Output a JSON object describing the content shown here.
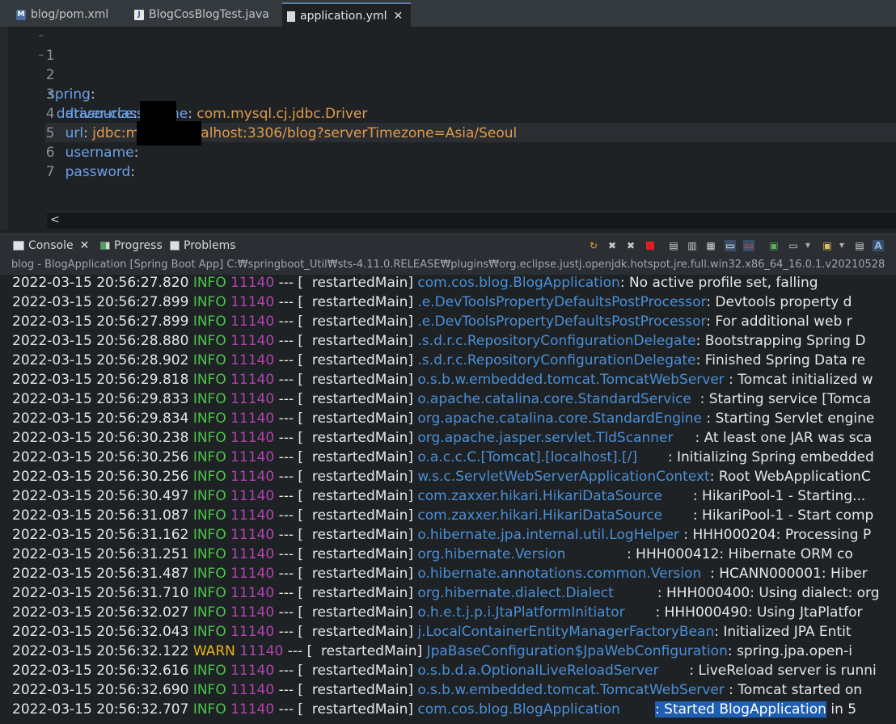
{
  "editor_tabs": [
    {
      "label": "blog/pom.xml",
      "icon": "maven-file-icon"
    },
    {
      "label": "BlogCosBlogTest.java",
      "icon": "java-file-icon"
    },
    {
      "label": "application.yml",
      "icon": "yaml-file-icon",
      "active": true
    }
  ],
  "editor": {
    "lines": [
      {
        "no": "1",
        "fold": "−",
        "key": "spring",
        "colon": ":",
        "value": ""
      },
      {
        "no": "2",
        "fold": "−",
        "key": "  datasource",
        "colon": ":",
        "value": ""
      },
      {
        "no": "3",
        "key": "    driver-class-name",
        "colon": ": ",
        "value": "com.mysql.cj.jdbc.Driver"
      },
      {
        "no": "4",
        "key": "    url",
        "colon": ": ",
        "value": "jdbc:mysql://localhost:3306/blog?serverTimezone=Asia/Seoul"
      },
      {
        "no": "5",
        "key": "    username",
        "colon": ":",
        "value": ""
      },
      {
        "no": "6",
        "key": "    password",
        "colon": ":",
        "value": ""
      },
      {
        "no": "7",
        "key": "",
        "colon": "",
        "value": ""
      }
    ],
    "hscroll_arrow": "<"
  },
  "console_tabs": [
    {
      "label": "Console",
      "icon": "console-icon",
      "close": "✕"
    },
    {
      "label": "Progress",
      "icon": "progress-icon"
    },
    {
      "label": "Problems",
      "icon": "problems-icon"
    }
  ],
  "console_header": "blog - BlogApplication [Spring Boot App] C:₩springboot_Util₩sts-4.11.0.RELEASE₩plugins₩org.eclipse.justj.openjdk.hotspot.jre.full.win32.x86_64_16.0.1.v20210528",
  "log_lines": [
    {
      "ts": "2022-03-15 20:56:27.820",
      "level": "INFO",
      "pid": "11140",
      "thread": "[  restartedMain]",
      "logger": "com.cos.blog.BlogApplication",
      "msg": ": No active profile set, falling"
    },
    {
      "ts": "2022-03-15 20:56:27.899",
      "level": "INFO",
      "pid": "11140",
      "thread": "[  restartedMain]",
      "logger": ".e.DevToolsPropertyDefaultsPostProcessor",
      "msg": ": Devtools property d"
    },
    {
      "ts": "2022-03-15 20:56:27.899",
      "level": "INFO",
      "pid": "11140",
      "thread": "[  restartedMain]",
      "logger": ".e.DevToolsPropertyDefaultsPostProcessor",
      "msg": ": For additional web r"
    },
    {
      "ts": "2022-03-15 20:56:28.880",
      "level": "INFO",
      "pid": "11140",
      "thread": "[  restartedMain]",
      "logger": ".s.d.r.c.RepositoryConfigurationDelegate",
      "msg": ": Bootstrapping Spring D"
    },
    {
      "ts": "2022-03-15 20:56:28.902",
      "level": "INFO",
      "pid": "11140",
      "thread": "[  restartedMain]",
      "logger": ".s.d.r.c.RepositoryConfigurationDelegate",
      "msg": ": Finished Spring Data re"
    },
    {
      "ts": "2022-03-15 20:56:29.818",
      "level": "INFO",
      "pid": "11140",
      "thread": "[  restartedMain]",
      "logger": "o.s.b.w.embedded.tomcat.TomcatWebServer",
      "msg": " : Tomcat initialized w"
    },
    {
      "ts": "2022-03-15 20:56:29.833",
      "level": "INFO",
      "pid": "11140",
      "thread": "[  restartedMain]",
      "logger": "o.apache.catalina.core.StandardService",
      "msg": "  : Starting service [Tomca"
    },
    {
      "ts": "2022-03-15 20:56:29.834",
      "level": "INFO",
      "pid": "11140",
      "thread": "[  restartedMain]",
      "logger": "org.apache.catalina.core.StandardEngine",
      "msg": " : Starting Servlet engine"
    },
    {
      "ts": "2022-03-15 20:56:30.238",
      "level": "INFO",
      "pid": "11140",
      "thread": "[  restartedMain]",
      "logger": "org.apache.jasper.servlet.TldScanner",
      "msg": "     : At least one JAR was sca"
    },
    {
      "ts": "2022-03-15 20:56:30.256",
      "level": "INFO",
      "pid": "11140",
      "thread": "[  restartedMain]",
      "logger": "o.a.c.c.C.[Tomcat].[localhost].[/]",
      "msg": "       : Initializing Spring embedded"
    },
    {
      "ts": "2022-03-15 20:56:30.256",
      "level": "INFO",
      "pid": "11140",
      "thread": "[  restartedMain]",
      "logger": "w.s.c.ServletWebServerApplicationContext",
      "msg": ": Root WebApplicationC"
    },
    {
      "ts": "2022-03-15 20:56:30.497",
      "level": "INFO",
      "pid": "11140",
      "thread": "[  restartedMain]",
      "logger": "com.zaxxer.hikari.HikariDataSource",
      "msg": "       : HikariPool-1 - Starting..."
    },
    {
      "ts": "2022-03-15 20:56:31.087",
      "level": "INFO",
      "pid": "11140",
      "thread": "[  restartedMain]",
      "logger": "com.zaxxer.hikari.HikariDataSource",
      "msg": "       : HikariPool-1 - Start comp"
    },
    {
      "ts": "2022-03-15 20:56:31.162",
      "level": "INFO",
      "pid": "11140",
      "thread": "[  restartedMain]",
      "logger": "o.hibernate.jpa.internal.util.LogHelper",
      "msg": " : HHH000204: Processing P"
    },
    {
      "ts": "2022-03-15 20:56:31.251",
      "level": "INFO",
      "pid": "11140",
      "thread": "[  restartedMain]",
      "logger": "org.hibernate.Version",
      "msg": "              : HHH000412: Hibernate ORM co"
    },
    {
      "ts": "2022-03-15 20:56:31.487",
      "level": "INFO",
      "pid": "11140",
      "thread": "[  restartedMain]",
      "logger": "o.hibernate.annotations.common.Version",
      "msg": "  : HCANN000001: Hiber"
    },
    {
      "ts": "2022-03-15 20:56:31.710",
      "level": "INFO",
      "pid": "11140",
      "thread": "[  restartedMain]",
      "logger": "org.hibernate.dialect.Dialect",
      "msg": "          : HHH000400: Using dialect: org"
    },
    {
      "ts": "2022-03-15 20:56:32.027",
      "level": "INFO",
      "pid": "11140",
      "thread": "[  restartedMain]",
      "logger": "o.h.e.t.j.p.i.JtaPlatformInitiator",
      "msg": "       : HHH000490: Using JtaPlatfor"
    },
    {
      "ts": "2022-03-15 20:56:32.043",
      "level": "INFO",
      "pid": "11140",
      "thread": "[  restartedMain]",
      "logger": "j.LocalContainerEntityManagerFactoryBean",
      "msg": ": Initialized JPA Entit"
    },
    {
      "ts": "2022-03-15 20:56:32.122",
      "level": "WARN",
      "pid": "11140",
      "thread": "[  restartedMain]",
      "logger": "JpaBaseConfiguration$JpaWebConfiguration",
      "msg": ": spring.jpa.open-i"
    },
    {
      "ts": "2022-03-15 20:56:32.616",
      "level": "INFO",
      "pid": "11140",
      "thread": "[  restartedMain]",
      "logger": "o.s.b.d.a.OptionalLiveReloadServer",
      "msg": "       : LiveReload server is runni"
    },
    {
      "ts": "2022-03-15 20:56:32.690",
      "level": "INFO",
      "pid": "11140",
      "thread": "[  restartedMain]",
      "logger": "o.s.b.w.embedded.tomcat.TomcatWebServer",
      "msg": " : Tomcat started on "
    },
    {
      "ts": "2022-03-15 20:56:32.707",
      "level": "INFO",
      "pid": "11140",
      "thread": "[  restartedMain]",
      "logger": "com.cos.blog.BlogApplication",
      "msg": "        ",
      "selected": ": Started BlogApplication",
      "tail": " in 5"
    }
  ],
  "colors": {
    "info": "#4cc44a",
    "warn": "#e8b31c",
    "pid": "#b043b0",
    "logger": "#4a8fd6",
    "yaml_key": "#6aa0e6",
    "yaml_value": "#e09a4b"
  }
}
